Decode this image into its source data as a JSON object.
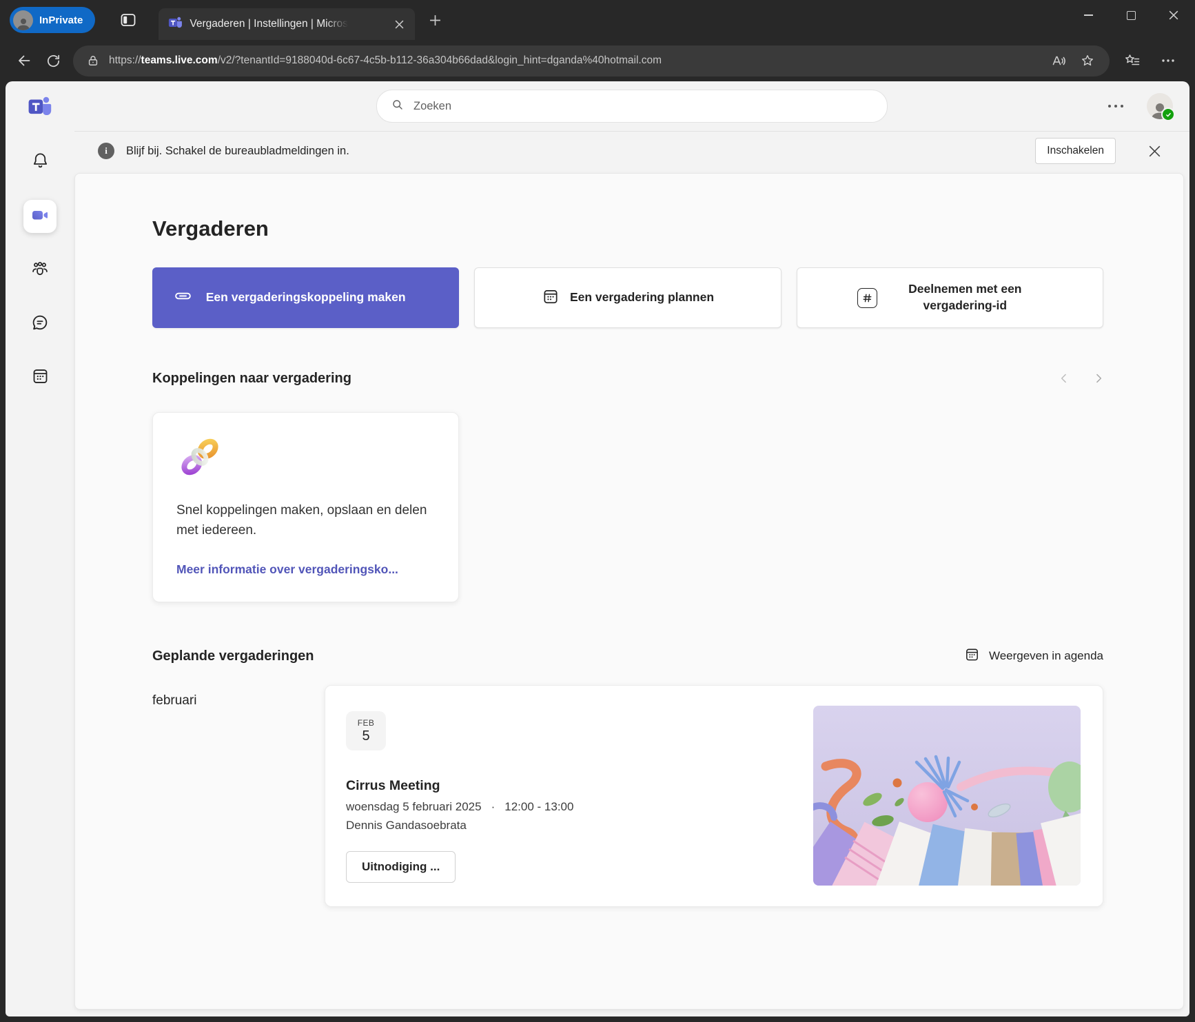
{
  "browser": {
    "inprivate_label": "InPrivate",
    "tab_title": "Vergaderen | Instellingen | Micros",
    "url_prefix": "https://",
    "url_domain": "teams.live.com",
    "url_rest": "/v2/?tenantId=9188040d-6c67-4c5b-b112-36a304b66dad&login_hint=dganda%40hotmail.com"
  },
  "header": {
    "search_placeholder": "Zoeken"
  },
  "banner": {
    "info_glyph": "i",
    "message": "Blijf bij. Schakel de bureaubladmeldingen in.",
    "enable_button": "Inschakelen"
  },
  "page": {
    "title": "Vergaderen",
    "actions": {
      "create_link": "Een vergaderingskoppeling maken",
      "plan_meeting": "Een vergadering plannen",
      "join_with_id": "Deelnemen met een vergadering-id"
    },
    "links_section": {
      "title": "Koppelingen naar vergadering",
      "card_text": "Snel koppelingen maken, opslaan en delen met iedereen.",
      "card_link": "Meer informatie over vergaderingsko..."
    },
    "meetings_section": {
      "title": "Geplande vergaderingen",
      "view_in_agenda": "Weergeven in agenda",
      "month_label": "februari",
      "meeting": {
        "month": "FEB",
        "day": "5",
        "title": "Cirrus Meeting",
        "date": "woensdag 5 februari 2025",
        "separator": "·",
        "time": "12:00 - 13:00",
        "organizer": "Dennis Gandasoebrata",
        "invite_button": "Uitnodiging ..."
      }
    }
  },
  "colors": {
    "brand_purple": "#5b5fc7",
    "link_purple": "#5155b8",
    "presence_available": "#13a10e",
    "inprivate_blue": "#1069c6",
    "chrome_dark": "#282828",
    "illustration_bg": "#d4cdea"
  },
  "icons": {
    "search-icon": "magnifier",
    "more-options-icon": "ellipsis",
    "info-icon": "i-circle",
    "link-icon": "chain",
    "calendar-icon": "calendar",
    "hash-icon": "#",
    "carousel-prev-icon": "chevron-left",
    "carousel-next-icon": "chevron-right",
    "bell-icon": "bell",
    "video-icon": "camera",
    "people-icon": "people",
    "chat-icon": "chat",
    "close-icon": "x",
    "lock-icon": "padlock",
    "favorite-icon": "star",
    "read-aloud-icon": "A-waves",
    "presence-available-icon": "check"
  }
}
